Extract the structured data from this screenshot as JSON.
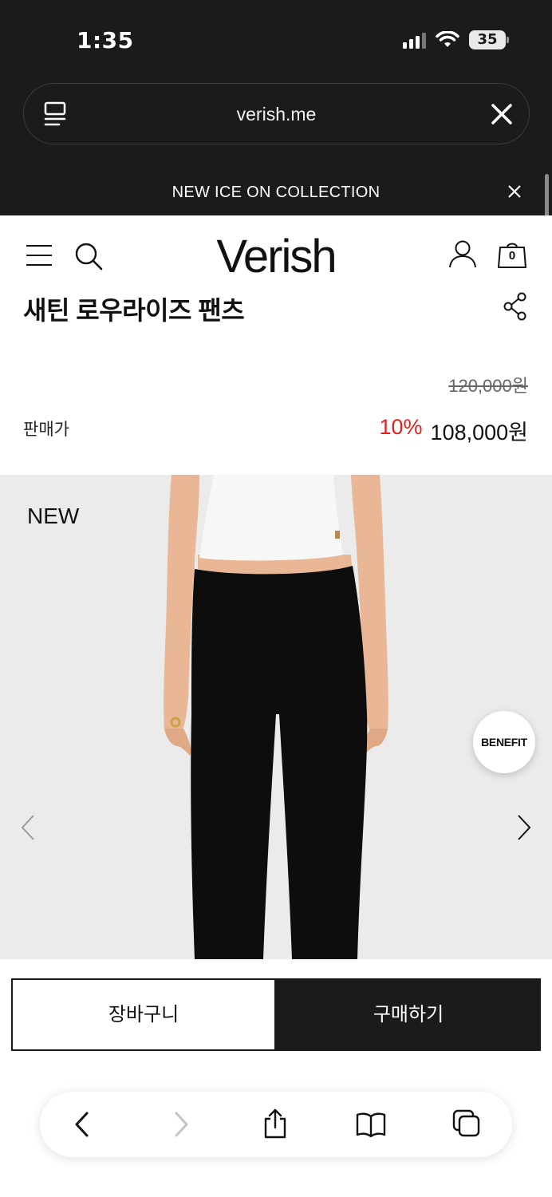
{
  "status_bar": {
    "time": "1:35",
    "battery": "35"
  },
  "browser": {
    "url": "verish.me"
  },
  "promo": {
    "text": "NEW ICE ON COLLECTION"
  },
  "header": {
    "logo": "Verish",
    "bag_count": "0"
  },
  "product": {
    "title": "새틴 로우라이즈 팬츠",
    "original_price": "120,000원",
    "price_label": "판매가",
    "discount": "10%",
    "sale_price": "108,000원"
  },
  "gallery": {
    "badge": "NEW",
    "benefit_label": "BENEFIT"
  },
  "actions": {
    "cart_label": "장바구니",
    "buy_label": "구매하기"
  },
  "colors": {
    "chrome_bg": "#1b1b1b",
    "discount_red": "#e0221f",
    "gallery_bg": "#ebebeb"
  }
}
